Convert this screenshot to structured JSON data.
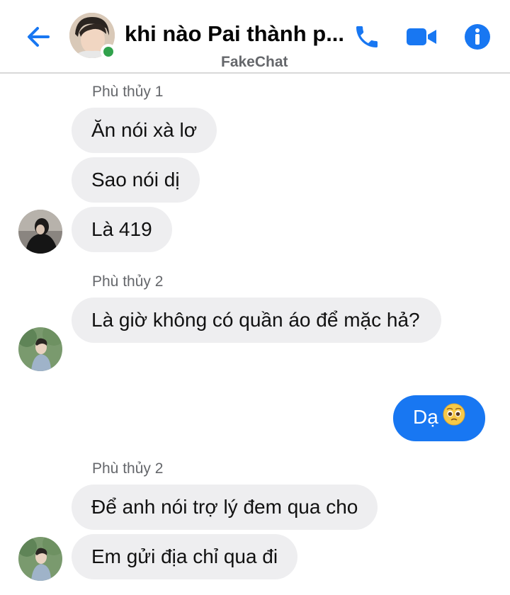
{
  "header": {
    "title": "khi nào Pai thành p...",
    "subtitle": "FakeChat"
  },
  "colors": {
    "accent": "#1877f2",
    "online": "#31a24c",
    "bubble_in": "#eeeef0"
  },
  "messages": [
    {
      "sender": "Phù thủy 1",
      "lines": [
        "Ăn nói xà lơ",
        "Sao nói dị",
        "Là 419"
      ]
    },
    {
      "sender": "Phù thủy 2",
      "lines": [
        "Là giờ không có quần áo để mặc hả?"
      ]
    },
    {
      "outgoing": "Dạ"
    },
    {
      "sender": "Phù thủy 2",
      "lines": [
        "Để anh nói trợ lý đem qua cho",
        "Em gửi địa chỉ qua đi"
      ]
    }
  ]
}
